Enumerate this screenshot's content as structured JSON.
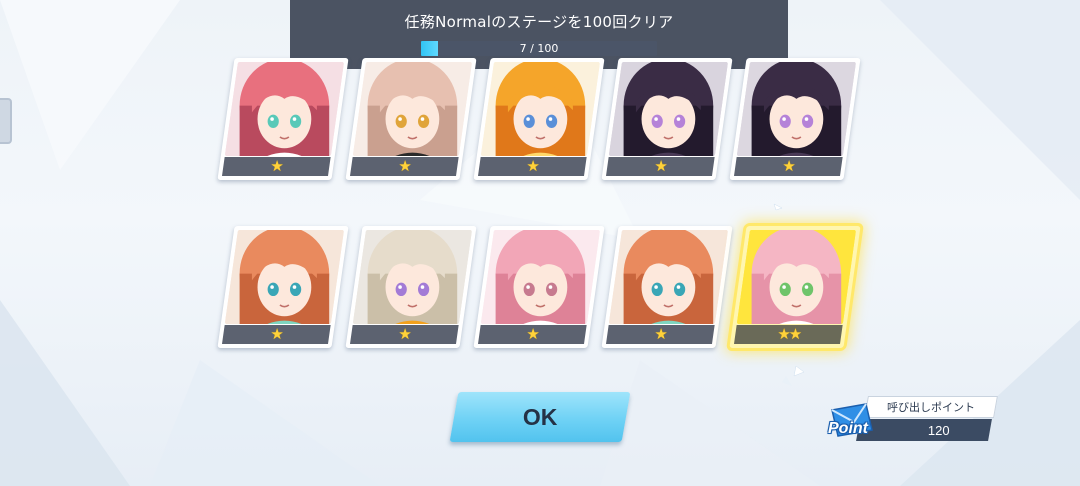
{
  "mission": {
    "title": "任務Normalのステージを100回クリア",
    "progress_text": "7 / 100",
    "progress_current": 7,
    "progress_total": 100
  },
  "cards": [
    {
      "name": "card-1",
      "stars": "★",
      "hair": "#e8707e",
      "hair2": "#b94a5e",
      "eye": "#59c9b8",
      "bg": "#f5dfe4",
      "accent": "#ffffff"
    },
    {
      "name": "card-2",
      "stars": "★",
      "hair": "#e7c0b0",
      "hair2": "#caa08f",
      "eye": "#e0a43a",
      "bg": "#f7ece6",
      "accent": "#2a2a2a"
    },
    {
      "name": "card-3",
      "stars": "★",
      "hair": "#f5a52a",
      "hair2": "#e0781a",
      "eye": "#5a8fd8",
      "bg": "#fbf1dc",
      "accent": "#ffd86a"
    },
    {
      "name": "card-4",
      "stars": "★",
      "hair": "#3a2c45",
      "hair2": "#231a2d",
      "eye": "#b582d8",
      "bg": "#d9d4de",
      "accent": "#4a3a57"
    },
    {
      "name": "card-5",
      "stars": "★",
      "hair": "#3a2c45",
      "hair2": "#231a2d",
      "eye": "#b582d8",
      "bg": "#dcd7e0",
      "accent": "#4a3a57"
    },
    {
      "name": "card-6",
      "stars": "★",
      "hair": "#e98a5e",
      "hair2": "#c9653c",
      "eye": "#3aa6b6",
      "bg": "#f6e6da",
      "accent": "#7fd6c0"
    },
    {
      "name": "card-7",
      "stars": "★",
      "hair": "#e6dccb",
      "hair2": "#cbbfa8",
      "eye": "#a37bd6",
      "bg": "#ebe7e1",
      "accent": "#f3a11c"
    },
    {
      "name": "card-8",
      "stars": "★",
      "hair": "#f2a6b7",
      "hair2": "#de8297",
      "eye": "#c77a8f",
      "bg": "#fbe9ee",
      "accent": "#ffffff"
    },
    {
      "name": "card-9",
      "stars": "★",
      "hair": "#e98a5e",
      "hair2": "#c9653c",
      "eye": "#3aa6b6",
      "bg": "#f6e6da",
      "accent": "#7fd6c0"
    },
    {
      "name": "card-10",
      "stars": "★★",
      "hair": "#f5b6c4",
      "hair2": "#e693a8",
      "eye": "#6fc46a",
      "bg": "#ffe53d",
      "accent": "#ffffff",
      "gold": true
    }
  ],
  "ok_button": {
    "label": "OK"
  },
  "points": {
    "label": "呼び出しポイント",
    "icon_text": "Point",
    "value": "120"
  }
}
